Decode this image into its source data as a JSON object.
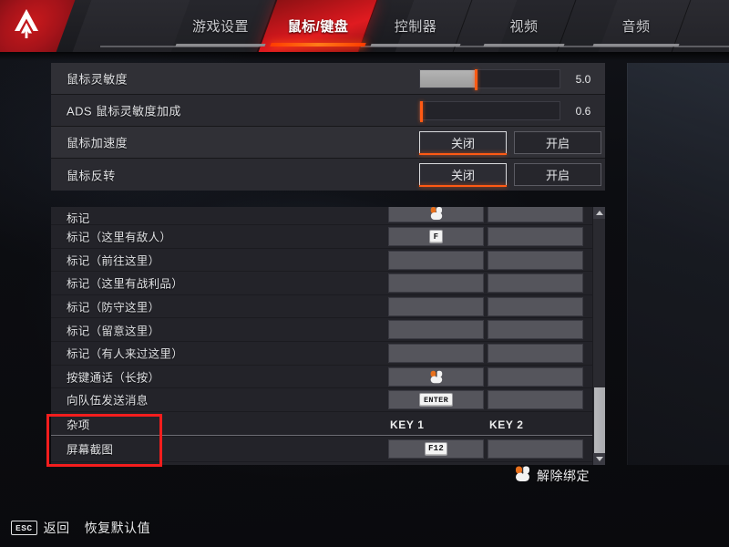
{
  "nav": {
    "logo_icon": "apex-legends-logo-icon",
    "tabs": [
      {
        "label": "游戏设置",
        "active": false
      },
      {
        "label": "鼠标/键盘",
        "active": true
      },
      {
        "label": "控制器",
        "active": false
      },
      {
        "label": "视频",
        "active": false
      },
      {
        "label": "音频",
        "active": false
      }
    ]
  },
  "colors": {
    "accent_orange": "#ff5a14",
    "brand_red": "#c4161b",
    "annotation_red": "#f41d1d",
    "panel_bg": "#303036",
    "row_alt_bg": "#2a2a30",
    "cell_bg": "#55555c"
  },
  "options": [
    {
      "label": "鼠标灵敏度",
      "type": "slider",
      "value": "5.0",
      "fill_pct": 40,
      "handle_pct": 40
    },
    {
      "label": "ADS 鼠标灵敏度加成",
      "type": "slider",
      "value": "0.6",
      "fill_pct": 0,
      "handle_pct": 0
    },
    {
      "label": "鼠标加速度",
      "type": "toggle",
      "off_label": "关闭",
      "on_label": "开启",
      "selected": "关闭"
    },
    {
      "label": "鼠标反转",
      "type": "toggle",
      "off_label": "关闭",
      "on_label": "开启",
      "selected": "关闭"
    }
  ],
  "bindings": {
    "column_headers": {
      "key1": "KEY 1",
      "key2": "KEY 2"
    },
    "rows": [
      {
        "name": "标记",
        "type": "bind",
        "key1": "",
        "key1_icon": "mouse-icon",
        "key2": ""
      },
      {
        "name": "标记（这里有敌人）",
        "type": "bind",
        "key1": "F",
        "key2": ""
      },
      {
        "name": "标记（前往这里）",
        "type": "bind",
        "key1": "",
        "key2": ""
      },
      {
        "name": "标记（这里有战利品）",
        "type": "bind",
        "key1": "",
        "key2": ""
      },
      {
        "name": "标记（防守这里）",
        "type": "bind",
        "key1": "",
        "key2": ""
      },
      {
        "name": "标记（留意这里）",
        "type": "bind",
        "key1": "",
        "key2": ""
      },
      {
        "name": "标记（有人来过这里）",
        "type": "bind",
        "key1": "",
        "key2": ""
      },
      {
        "name": "按键通话（长按）",
        "type": "bind",
        "key1": "",
        "key1_icon": "mouse-icon",
        "key2": ""
      },
      {
        "name": "向队伍发送消息",
        "type": "bind",
        "key1": "ENTER",
        "key2": ""
      },
      {
        "name": "杂项",
        "type": "header",
        "key1": "KEY 1",
        "key2": "KEY 2"
      },
      {
        "name": "屏幕截图",
        "type": "bind",
        "key1": "F12",
        "key2": ""
      }
    ]
  },
  "scrollbar": {
    "up_icon": "triangle-up-icon",
    "down_icon": "triangle-down-icon"
  },
  "unbind": {
    "label": "解除绑定",
    "icon": "mouse-icon"
  },
  "footer": {
    "back": {
      "key": "ESC",
      "label": "返回"
    },
    "reset": {
      "label": "恢复默认值"
    }
  },
  "annotation": {
    "shape": "rectangle",
    "color": "#f41d1d"
  }
}
